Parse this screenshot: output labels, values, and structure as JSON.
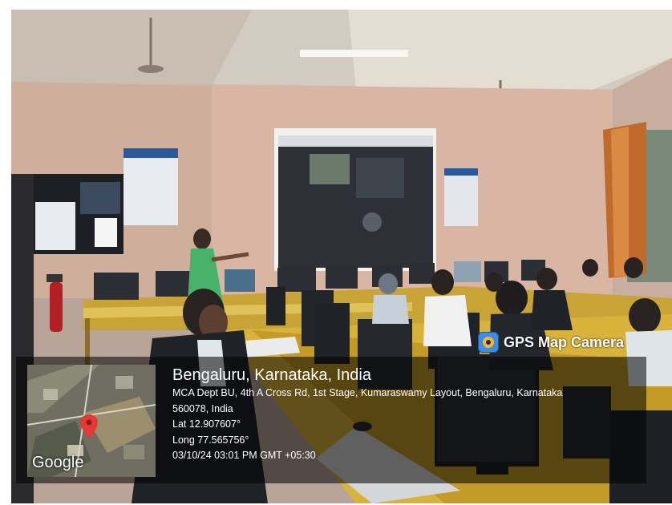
{
  "gps_camera": {
    "brand": "GPS Map Camera",
    "map_label": "Google",
    "city": "Bengaluru, Karnataka, India",
    "address_line1": "MCA Dept BU, 4th A Cross Rd, 1st Stage, Kumaraswamy Layout, Bengaluru, Karnataka",
    "address_line2": "560078, India",
    "lat": "Lat 12.907607°",
    "long": "Long 77.565756°",
    "datetime": "03/10/24 03:01 PM GMT +05:30"
  },
  "colors": {
    "wall": "#d9b8a6",
    "ceiling": "#e6e0d6",
    "desk": "#d8b23b",
    "curtain": "#c06a2c",
    "screen": "#2b2f35",
    "pin": "#e53935"
  },
  "icons": [
    "gps-camera-logo-icon",
    "map-pin-icon"
  ]
}
